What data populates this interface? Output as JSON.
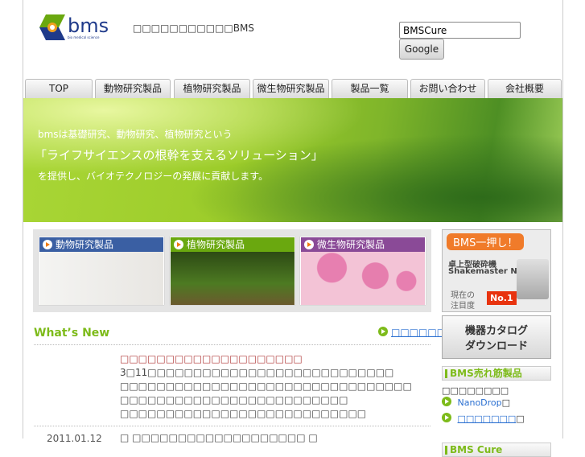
{
  "header": {
    "logo_text": "bms",
    "logo_sub": "bio medical science",
    "tagline": "□□□□□□□□□□□BMS",
    "search_value": "BMSCure",
    "search_button": "Google"
  },
  "nav": [
    "TOP",
    "動物研究製品",
    "植物研究製品",
    "微生物研究製品",
    "製品一覧",
    "お問い合わせ",
    "会社概要"
  ],
  "banner": {
    "line1": "bmsは基礎研究、動物研究、植物研究という",
    "line2": "「ライフサイエンスの根幹を支えるソリューション」",
    "line3": "を提供し、バイオテクノロジーの発展に貢献します。"
  },
  "tiles": [
    {
      "label": "動物研究製品",
      "color": "#3a5fa3"
    },
    {
      "label": "植物研究製品",
      "color": "#6aa80f"
    },
    {
      "label": "微生物研究製品",
      "color": "#8a4a97"
    }
  ],
  "whats_new": {
    "title": "What’s New",
    "more_link": "□□□□□□□",
    "items": [
      {
        "date": "",
        "headline": "□□□□□□□□□□□□□□□□□□□□",
        "body": [
          "3□11□□□□□□□□□□□□□□□□□□□□□□□□□□□",
          "□□□□□□□□□□□□□□□□□□□□□□□□□□□□□□□□",
          "□□□□□□□□□□□□□□□□□□□□□□□□□",
          "□□□□□□□□□□□□□□□□□□□□□□□□□□□"
        ]
      },
      {
        "date": "2011.01.12",
        "headline": "□ □□□□□□□□□□□□□□□□□□□ □"
      }
    ]
  },
  "sidebar": {
    "promo": {
      "bubble": "BMS一押し！",
      "line1": "卓上型破砕機",
      "line2": "Shakemaster Neo",
      "rank_label1": "現在の",
      "rank_label2": "注目度",
      "rank": "No.1"
    },
    "catalog": [
      "機器カタログ",
      "ダウンロード"
    ],
    "bestsellers_title": "BMS売れ筋製品",
    "bestsellers_intro": "□□□□□□□□",
    "links": [
      {
        "label": "NanoDrop",
        "suffix": "□"
      },
      {
        "label": "□□□□□□□",
        "suffix": "□"
      }
    ],
    "cure_title": "BMS Cure"
  }
}
